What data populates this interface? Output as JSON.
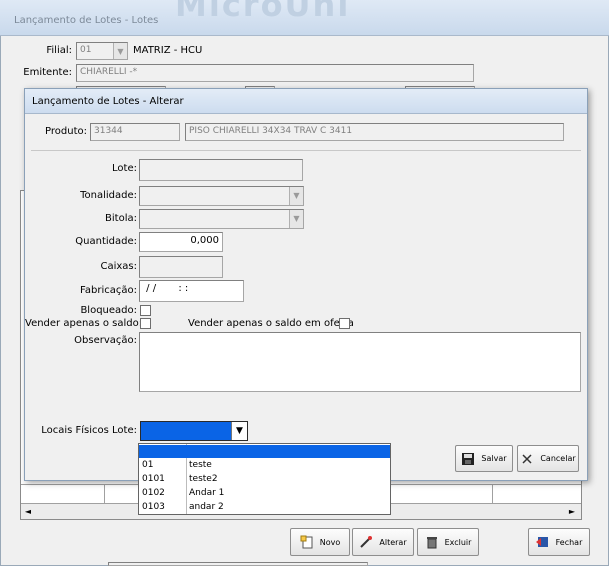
{
  "bg_window": {
    "title": "Lançamento de Lotes - Lotes",
    "logo_text": "MicroUni",
    "filial_label": "Filial:",
    "filial_code": "01",
    "filial_name": "MATRIZ - HCU",
    "emitente_label": "Emitente:",
    "emitente_value": "CHIARELLI -*"
  },
  "dialog": {
    "title": "Lançamento de Lotes - Alterar",
    "produto_label": "Produto:",
    "produto_code": "31344",
    "produto_desc": "PISO CHIARELLI 34X34 TRAV C   3411",
    "lote_label": "Lote:",
    "lote_value": "",
    "tonalidade_label": "Tonalidade:",
    "tonalidade_value": "",
    "bitola_label": "Bitola:",
    "bitola_value": "",
    "quantidade_label": "Quantidade:",
    "quantidade_value": "0,000",
    "caixas_label": "Caixas:",
    "caixas_value": "",
    "fabricacao_label": "Fabricação:",
    "fabricacao_value": " / /       : :",
    "bloqueado_label": "Bloqueado:",
    "vender_saldo_label": "Vender apenas o saldo:",
    "vender_oferta_label": "Vender apenas o saldo em oferta",
    "observacao_label": "Observação:",
    "observacao_value": "",
    "locais_label": "Locais Físicos Lote:",
    "locais_value": "",
    "salvar_label": "Salvar",
    "cancelar_label": "Cancelar"
  },
  "locais_options": [
    {
      "code": "01",
      "name": "teste"
    },
    {
      "code": "0101",
      "name": "teste2"
    },
    {
      "code": "0102",
      "name": "Andar 1"
    },
    {
      "code": "0103",
      "name": "andar 2"
    }
  ],
  "toolbar": {
    "novo_label": "Novo",
    "alterar_label": "Alterar",
    "excluir_label": "Excluir",
    "fechar_label": "Fechar"
  },
  "colors": {
    "selection": "#0a64e6",
    "titlebar": "#cddcef"
  }
}
